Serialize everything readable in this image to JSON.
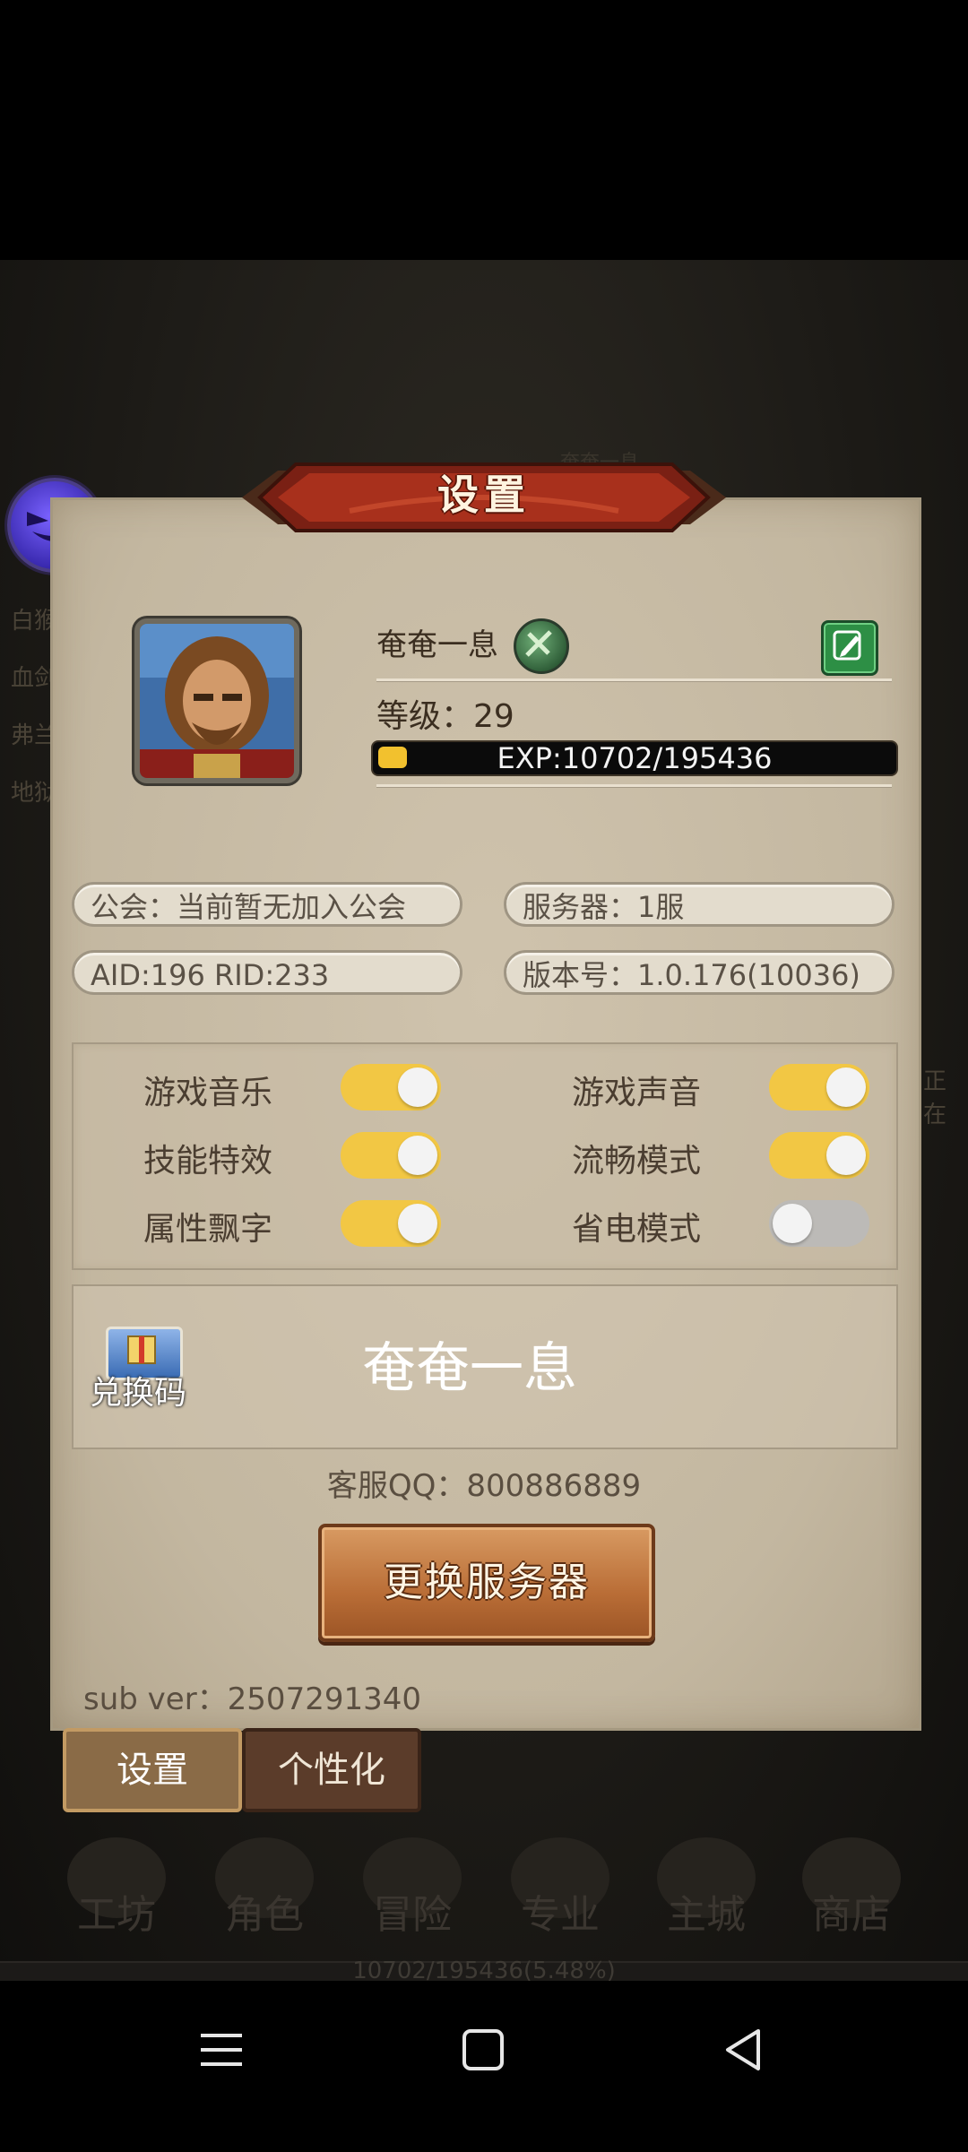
{
  "background": {
    "side_list": [
      "白猴",
      "血剑",
      "弗兰",
      "地狱"
    ],
    "right_text": "正在",
    "bottom_nav": [
      "工坊",
      "角色",
      "冒险",
      "专业",
      "主城",
      "商店"
    ],
    "bottom_exp": "10702/195436(5.48%)",
    "faint_name": "奄奄一息"
  },
  "dialog": {
    "title": "设置",
    "player": {
      "name": "奄奄一息",
      "level_text": "等级：29",
      "exp_text": "EXP:10702/195436",
      "exp_progress": 0.0548
    },
    "info": {
      "guild": "公会：当前暂无加入公会",
      "server": "服务器：1服",
      "ids": "AID:196   RID:233",
      "version": "版本号：1.0.176(10036)"
    },
    "toggles": [
      {
        "label": "游戏音乐",
        "on": true
      },
      {
        "label": "游戏声音",
        "on": true
      },
      {
        "label": "技能特效",
        "on": true
      },
      {
        "label": "流畅模式",
        "on": true
      },
      {
        "label": "属性飘字",
        "on": true
      },
      {
        "label": "省电模式",
        "on": false
      }
    ],
    "redeem": {
      "label": "兑换码",
      "overlay_name": "奄奄一息"
    },
    "support_qq": "客服QQ：800886889",
    "change_server_label": "更换服务器",
    "sub_ver": "sub ver：2507291340"
  },
  "tabs": {
    "settings": "设置",
    "personalize": "个性化"
  },
  "colors": {
    "toggle_on": "#f2c744",
    "toggle_off": "#bcbab7",
    "dialog_bg": "#c8bca6",
    "banner_red": "#a8301c"
  }
}
